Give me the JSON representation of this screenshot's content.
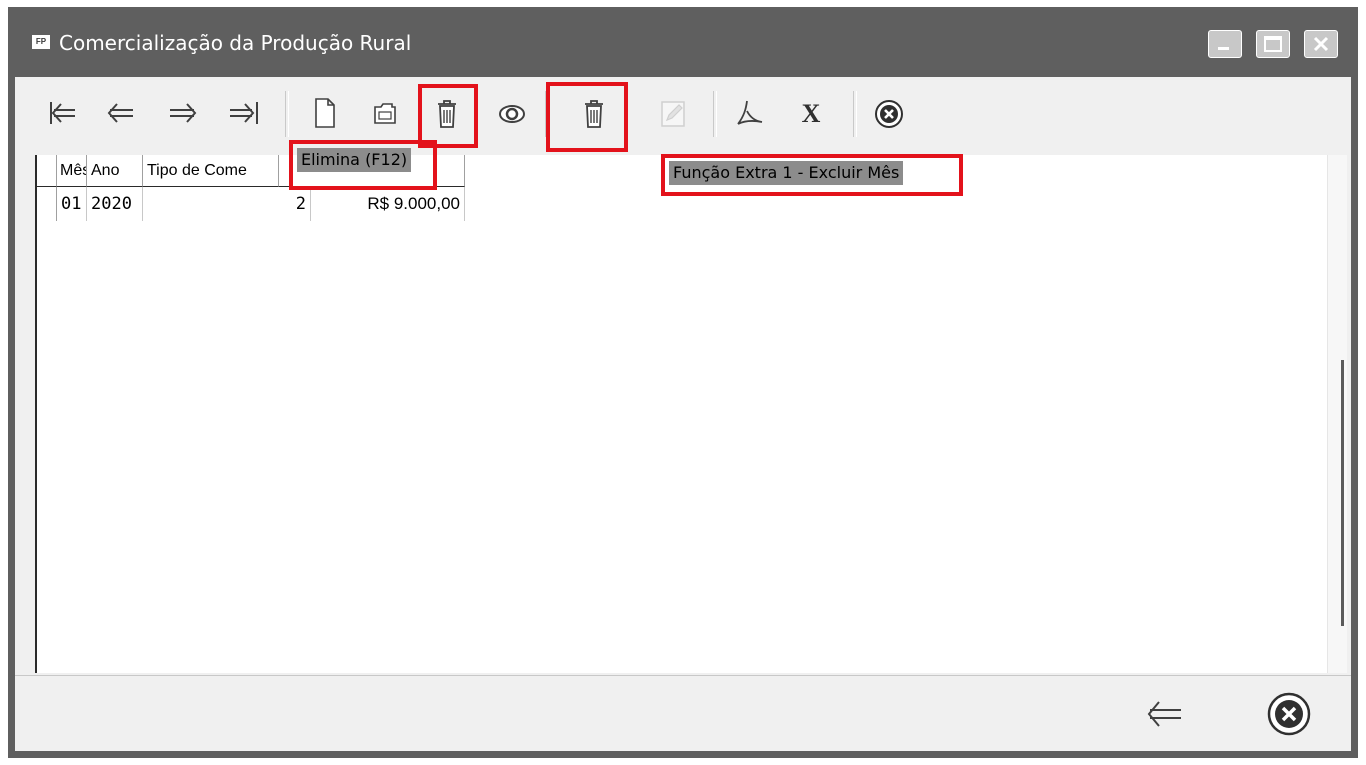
{
  "window": {
    "icon_text": "FP",
    "title": "Comercialização da Produção Rural",
    "controls": [
      "minimize-icon",
      "maximize-icon",
      "close-icon"
    ]
  },
  "toolbar": {
    "buttons": [
      {
        "name": "first-record",
        "icon": "first-arrow-icon"
      },
      {
        "name": "previous-record",
        "icon": "left-arrow-icon"
      },
      {
        "name": "next-record",
        "icon": "right-arrow-icon"
      },
      {
        "name": "last-record",
        "icon": "last-arrow-icon"
      },
      {
        "name": "new",
        "icon": "new-document-icon"
      },
      {
        "name": "edit",
        "icon": "folder-icon"
      },
      {
        "name": "delete",
        "icon": "trash-icon",
        "tooltip": "Elimina (F12)"
      },
      {
        "name": "view",
        "icon": "eye-icon"
      },
      {
        "name": "extra-function-1",
        "icon": "trash-icon",
        "tooltip": "Função Extra 1 - Excluir Mês"
      },
      {
        "name": "edit-disabled",
        "icon": "pencil-icon",
        "disabled": true
      },
      {
        "name": "export-pdf",
        "icon": "pdf-icon"
      },
      {
        "name": "export-excel",
        "icon": "excel-icon"
      },
      {
        "name": "close",
        "icon": "close-circle-icon"
      }
    ]
  },
  "grid": {
    "columns": [
      "Mês",
      "Ano",
      "Tipo de Come",
      ""
    ],
    "rows": [
      [
        "01",
        "2020",
        "2",
        "R$ 9.000,00"
      ]
    ]
  },
  "tooltips": {
    "delete": "Elimina (F12)",
    "extra_function": "Função Extra 1 - Excluir Mês"
  },
  "footer": {
    "buttons": [
      "back-arrow-icon",
      "close-circle-icon"
    ]
  },
  "colors": {
    "highlight": "#e3121b",
    "titlebar": "#5f5f5f",
    "tooltip_bg": "#8c8c8c"
  }
}
